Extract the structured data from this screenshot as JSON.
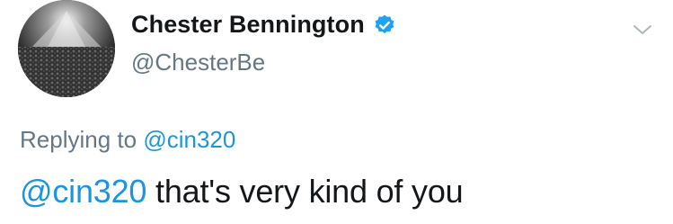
{
  "author": {
    "display_name": "Chester Bennington",
    "handle": "@ChesterBe",
    "verified": true,
    "avatar_icon": "concert-crowd-photo"
  },
  "menu": {
    "icon": "chevron-down-icon"
  },
  "reply": {
    "prefix": "Replying to",
    "mention": "@cin320"
  },
  "tweet": {
    "mention": "@cin320",
    "text": " that's very kind of you"
  },
  "colors": {
    "link": "#1b95e0",
    "secondary_text": "#657786",
    "primary_text": "#14171a",
    "verified_badge": "#1da1f2"
  }
}
